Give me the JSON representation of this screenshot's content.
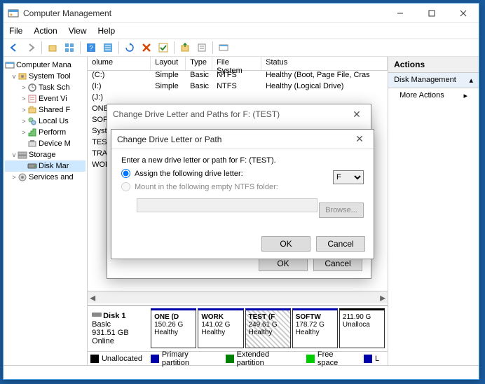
{
  "window": {
    "title": "Computer Management",
    "menu": [
      "File",
      "Action",
      "View",
      "Help"
    ]
  },
  "tree": {
    "root": "Computer Mana",
    "items": [
      {
        "exp": "v",
        "indent": 0,
        "label": "System Tool"
      },
      {
        "exp": ">",
        "indent": 1,
        "label": "Task Sch"
      },
      {
        "exp": ">",
        "indent": 1,
        "label": "Event Vi"
      },
      {
        "exp": ">",
        "indent": 1,
        "label": "Shared F"
      },
      {
        "exp": ">",
        "indent": 1,
        "label": "Local Us"
      },
      {
        "exp": ">",
        "indent": 1,
        "label": "Perform"
      },
      {
        "exp": "",
        "indent": 1,
        "label": "Device M"
      },
      {
        "exp": "v",
        "indent": 0,
        "label": "Storage"
      },
      {
        "exp": "",
        "indent": 1,
        "label": "Disk Mar",
        "sel": true
      },
      {
        "exp": ">",
        "indent": 0,
        "label": "Services and"
      }
    ]
  },
  "grid": {
    "headers": [
      "olume",
      "Layout",
      "Type",
      "File System",
      "Status"
    ],
    "rows": [
      {
        "c": [
          "(C:)",
          "Simple",
          "Basic",
          "NTFS",
          "Healthy (Boot, Page File, Cras"
        ]
      },
      {
        "c": [
          "(I:)",
          "Simple",
          "Basic",
          "NTFS",
          "Healthy (Logical Drive)"
        ]
      },
      {
        "c": [
          "(J:)",
          "",
          "",
          "",
          ""
        ]
      },
      {
        "c": [
          "ONE",
          "",
          "",
          "",
          ""
        ]
      },
      {
        "c": [
          "SOFT",
          "",
          "",
          "",
          ""
        ]
      },
      {
        "c": [
          "Syste",
          "",
          "",
          "",
          ""
        ]
      },
      {
        "c": [
          "TEST",
          "",
          "",
          "",
          ""
        ]
      },
      {
        "c": [
          "TRAC",
          "",
          "",
          "",
          ""
        ]
      },
      {
        "c": [
          "WOR",
          "",
          "",
          "",
          ""
        ]
      }
    ]
  },
  "disk": {
    "name": "Disk 1",
    "type": "Basic",
    "size": "931.51 GB",
    "status": "Online",
    "parts": [
      {
        "name": "ONE (D",
        "size": "150.26 G",
        "status": "Healthy"
      },
      {
        "name": "WORK",
        "size": "141.02 G",
        "status": "Healthy"
      },
      {
        "name": "TEST (F",
        "size": "249.61 G",
        "status": "Healthy",
        "hatch": true
      },
      {
        "name": "SOFTW",
        "size": "178.72 G",
        "status": "Healthy"
      },
      {
        "name": "",
        "size": "211.90 G",
        "status": "Unalloca",
        "unalloc": true
      }
    ]
  },
  "legend": {
    "items": [
      {
        "color": "#000",
        "label": "Unallocated"
      },
      {
        "color": "#0000aa",
        "label": "Primary partition"
      },
      {
        "color": "#008000",
        "label": "Extended partition"
      },
      {
        "color": "#00cc00",
        "label": "Free space"
      },
      {
        "color": "#0000aa",
        "label": "L"
      }
    ]
  },
  "actions": {
    "header": "Actions",
    "section": "Disk Management",
    "item": "More Actions"
  },
  "dialog1": {
    "title": "Change Drive Letter and Paths for F: (TEST)",
    "ok": "OK",
    "cancel": "Cancel"
  },
  "dialog2": {
    "title": "Change Drive Letter or Path",
    "prompt": "Enter a new drive letter or path for F: (TEST).",
    "opt1": "Assign the following drive letter:",
    "opt2": "Mount in the following empty NTFS folder:",
    "drive": "F",
    "browse": "Browse...",
    "ok": "OK",
    "cancel": "Cancel"
  }
}
